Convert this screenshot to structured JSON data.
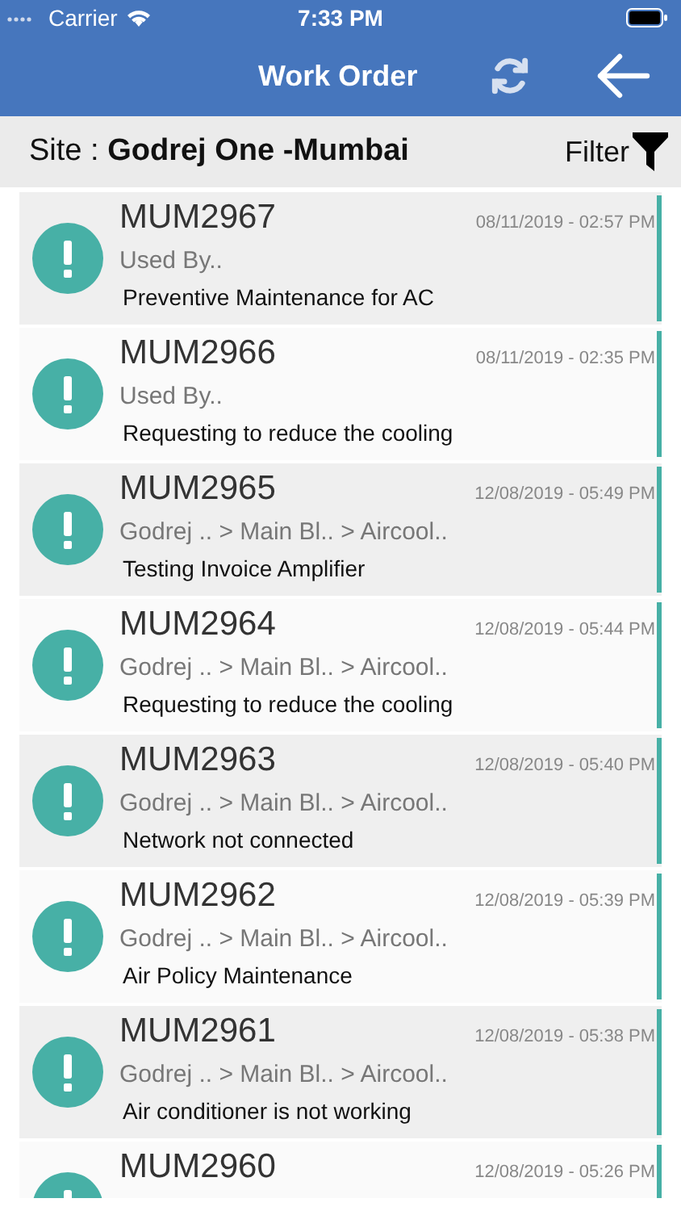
{
  "status_bar": {
    "carrier": "Carrier",
    "time": "7:33 PM"
  },
  "nav": {
    "title": "Work Order"
  },
  "site_bar": {
    "label": "Site : ",
    "site": "Godrej One -Mumbai",
    "filter": "Filter"
  },
  "orders": [
    {
      "code": "MUM2967",
      "date": "08/11/2019 - 02:57 PM",
      "location": "Used By..",
      "description": "Preventive Maintenance for AC"
    },
    {
      "code": "MUM2966",
      "date": "08/11/2019 - 02:35 PM",
      "location": "Used By..",
      "description": "Requesting to reduce the cooling"
    },
    {
      "code": "MUM2965",
      "date": "12/08/2019 - 05:49 PM",
      "location": "Godrej .. > Main Bl.. > Aircool..",
      "description": "Testing Invoice Amplifier"
    },
    {
      "code": "MUM2964",
      "date": "12/08/2019 - 05:44 PM",
      "location": "Godrej .. > Main Bl.. > Aircool..",
      "description": "Requesting to reduce the cooling"
    },
    {
      "code": "MUM2963",
      "date": "12/08/2019 - 05:40 PM",
      "location": "Godrej .. > Main Bl.. > Aircool..",
      "description": "Network not connected"
    },
    {
      "code": "MUM2962",
      "date": "12/08/2019 - 05:39 PM",
      "location": "Godrej .. > Main Bl.. > Aircool..",
      "description": "Air Policy Maintenance"
    },
    {
      "code": "MUM2961",
      "date": "12/08/2019 - 05:38 PM",
      "location": "Godrej .. > Main Bl.. > Aircool..",
      "description": "Air conditioner is not working"
    },
    {
      "code": "MUM2960",
      "date": "12/08/2019 - 05:26 PM"
    }
  ]
}
